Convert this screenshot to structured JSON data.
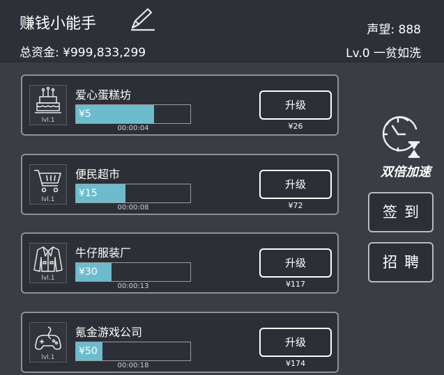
{
  "header": {
    "title": "赚钱小能手",
    "funds": "总资金: ¥999,833,299",
    "fame": "声望: 888",
    "level": "Lv.0 一贫如洗",
    "edit_icon": "pencil-icon"
  },
  "businesses": [
    {
      "name": "爱心蛋糕坊",
      "icon": "cake-icon",
      "level": "lvl.1",
      "income": "¥5",
      "progress": 0.68,
      "time": "00:00:04",
      "button": "升级",
      "cost": "¥26"
    },
    {
      "name": "便民超市",
      "icon": "shopping-cart-icon",
      "level": "lvl.1",
      "income": "¥15",
      "progress": 0.43,
      "time": "00:00:08",
      "button": "升级",
      "cost": "¥72"
    },
    {
      "name": "牛仔服装厂",
      "icon": "jacket-icon",
      "level": "lvl.1",
      "income": "¥30",
      "progress": 0.31,
      "time": "00:00:13",
      "button": "升级",
      "cost": "¥117"
    },
    {
      "name": "氪金游戏公司",
      "icon": "gamepad-icon",
      "level": "lvl.1",
      "income": "¥50",
      "progress": 0.23,
      "time": "00:00:18",
      "button": "升级",
      "cost": "¥174"
    }
  ],
  "side": {
    "speed_icon": "clock-hourglass-icon",
    "speed_label": "双倍加速",
    "checkin_label": "签到",
    "recruit_label": "招聘"
  },
  "colors": {
    "background": "#3a3d44",
    "header": "#2d3037",
    "progress_fill": "#6cbccd",
    "card_border": "#8e9198"
  }
}
